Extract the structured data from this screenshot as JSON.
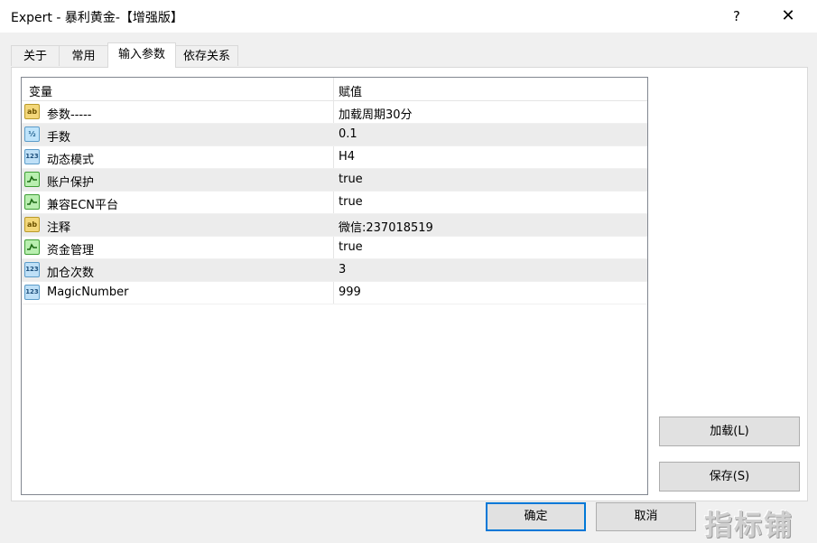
{
  "window": {
    "title": "Expert - 暴利黄金-【增强版】",
    "help": "?",
    "close": "✕"
  },
  "tabs": [
    {
      "label": "关于"
    },
    {
      "label": "常用"
    },
    {
      "label": "输入参数"
    },
    {
      "label": "依存关系"
    }
  ],
  "grid": {
    "columns": {
      "variable": "变量",
      "value": "赋值"
    },
    "rows": [
      {
        "icon": "ab",
        "name": "参数-----",
        "value": "加载周期30分"
      },
      {
        "icon": "frac",
        "name": "手数",
        "value": "0.1"
      },
      {
        "icon": "num",
        "name": "动态模式",
        "value": "H4"
      },
      {
        "icon": "bool",
        "name": "账户保护",
        "value": "true"
      },
      {
        "icon": "bool",
        "name": "兼容ECN平台",
        "value": "true"
      },
      {
        "icon": "ab",
        "name": "注释",
        "value": "微信:237018519"
      },
      {
        "icon": "bool",
        "name": "资金管理",
        "value": "true"
      },
      {
        "icon": "num",
        "name": "加仓次数",
        "value": "3"
      },
      {
        "icon": "num",
        "name": "MagicNumber",
        "value": "999"
      }
    ]
  },
  "icons": {
    "ab": "ab",
    "frac": "½",
    "num": "123",
    "bool": "bool-icon"
  },
  "buttons": {
    "load": "加载(L)",
    "save": "保存(S)",
    "ok": "确定",
    "cancel": "取消"
  },
  "watermark": "指标铺"
}
